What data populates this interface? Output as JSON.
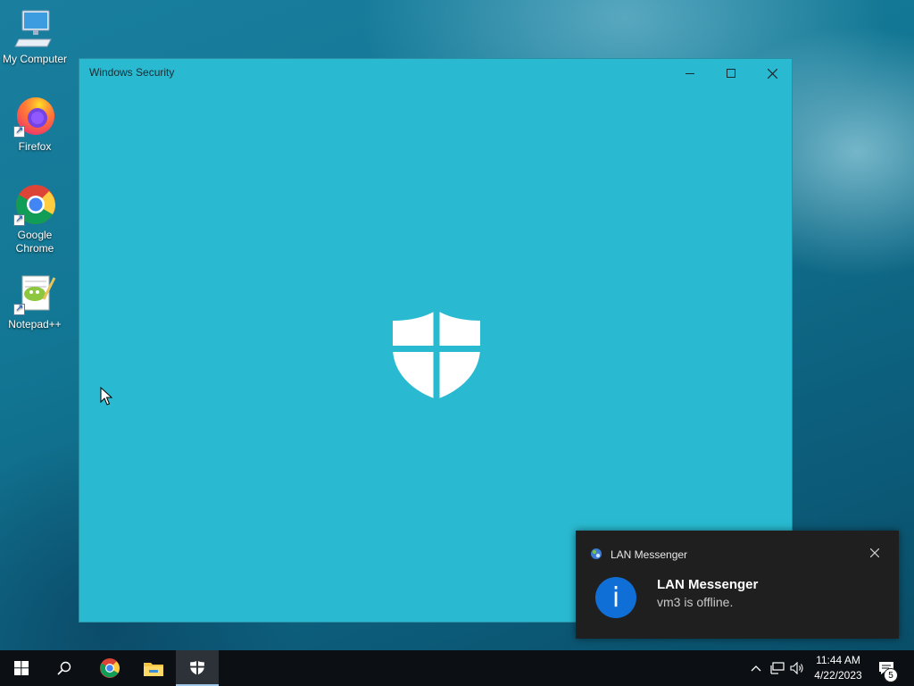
{
  "desktop": {
    "icons": [
      {
        "label": "My Computer",
        "icon": "computer-icon"
      },
      {
        "label": "Firefox",
        "icon": "firefox-icon"
      },
      {
        "label": "Google Chrome",
        "icon": "chrome-icon"
      },
      {
        "label": "Notepad++",
        "icon": "notepadpp-icon"
      }
    ]
  },
  "window": {
    "title": "Windows Security",
    "controls": {
      "minimize": "minimize-icon",
      "maximize": "maximize-icon",
      "close": "close-icon"
    },
    "splash_icon": "windows-defender-shield-icon",
    "background": "#29b9d0"
  },
  "notification": {
    "app_name": "LAN Messenger",
    "title": "LAN Messenger",
    "message": "vm3 is offline.",
    "icon": "info-icon",
    "accent": "#0f6fd6"
  },
  "taskbar": {
    "items": [
      "start-icon",
      "search-icon",
      "chrome-icon",
      "file-explorer-icon",
      "windows-security-icon"
    ],
    "active_item": "windows-security-icon",
    "clock": {
      "time": "11:44 AM",
      "date": "4/22/2023"
    },
    "notifications_count": "5"
  }
}
